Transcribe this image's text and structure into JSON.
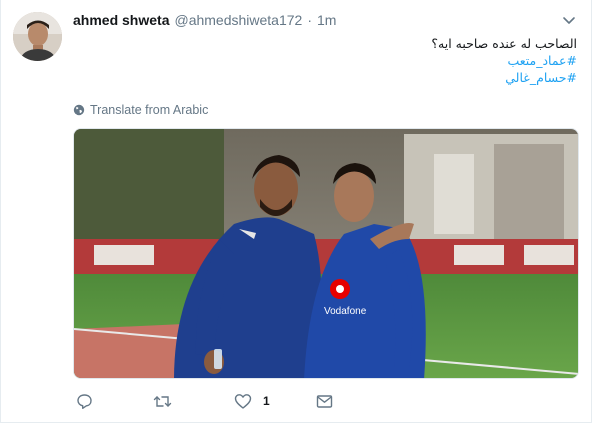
{
  "tweet": {
    "author_name": "ahmed shweta",
    "author_handle": "@ahmedshiweta172",
    "separator": "·",
    "time": "1m",
    "text_line": "الصاحب له عنده صاحبه ايه؟",
    "hashtags": [
      "#عماد_متعب",
      "#حسام_غالي"
    ],
    "translate_label": "Translate from Arabic",
    "like_count": "1"
  },
  "colors": {
    "link": "#1da1f2",
    "muted": "#657786",
    "text": "#14171a",
    "border": "#e6ecf0"
  },
  "icons": {
    "caret": "chevron-down-icon",
    "globe": "globe-icon",
    "reply": "reply-icon",
    "retweet": "retweet-icon",
    "like": "heart-icon",
    "dm": "envelope-icon"
  },
  "media": {
    "jersey_text": [
      "Vodafone"
    ]
  }
}
